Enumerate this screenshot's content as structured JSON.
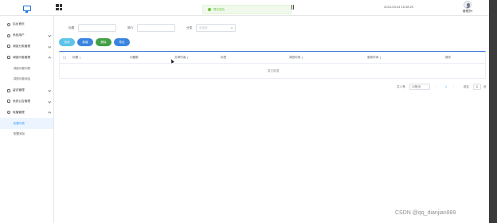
{
  "header": {
    "datetime": "2024-03-04 16:38:29",
    "username": "管理员",
    "user_caret": "▾"
  },
  "toast": {
    "message": "提交成功"
  },
  "sidebar": {
    "items": [
      {
        "label": "后台首页",
        "icon": "home-icon",
        "expanded": false,
        "has_children": false
      },
      {
        "label": "系统用户",
        "icon": "user-icon",
        "has_children": true,
        "expanded": false
      },
      {
        "label": "调查分类管理",
        "icon": "tag-icon",
        "has_children": true,
        "expanded": false
      },
      {
        "label": "调查问卷管理",
        "icon": "document-icon",
        "has_children": true,
        "expanded": true,
        "children": [
          {
            "label": "调查问卷列表"
          },
          {
            "label": "调查问卷添加"
          }
        ]
      },
      {
        "label": "留言管理",
        "icon": "message-icon",
        "has_children": true,
        "expanded": false
      },
      {
        "label": "系统公告管理",
        "icon": "notice-icon",
        "has_children": true,
        "expanded": false
      },
      {
        "label": "轮播管理",
        "icon": "picture-icon",
        "has_children": true,
        "expanded": true,
        "children": [
          {
            "label": "配置列表",
            "active": true
          },
          {
            "label": "配置添加"
          }
        ]
      }
    ]
  },
  "search": {
    "fields": [
      {
        "label": "标题",
        "value": ""
      },
      {
        "label": "简介",
        "value": ""
      },
      {
        "label": "分类",
        "placeholder": "请选择"
      }
    ]
  },
  "toolbar": {
    "buttons": [
      {
        "label": "查询",
        "color": "#5ec3e8"
      },
      {
        "label": "新增",
        "color": "#3a84e0"
      },
      {
        "label": "删除",
        "color": "#43a047"
      },
      {
        "label": "导出",
        "color": "#3a84e0"
      }
    ]
  },
  "table": {
    "columns": [
      "标题",
      "问题数",
      "文章作者",
      "标签",
      "调查时间",
      "更新时间",
      "操作"
    ],
    "rows": [],
    "empty_text": "暂无数据"
  },
  "pagination": {
    "total_text": "共 0 条",
    "page_size": "10条/页",
    "current_page": "1",
    "goto_label": "前往",
    "goto_value": "1",
    "page_suffix": "页",
    "prev": "‹",
    "next": "›"
  },
  "watermark": "CSDN @qq_dianjian889"
}
